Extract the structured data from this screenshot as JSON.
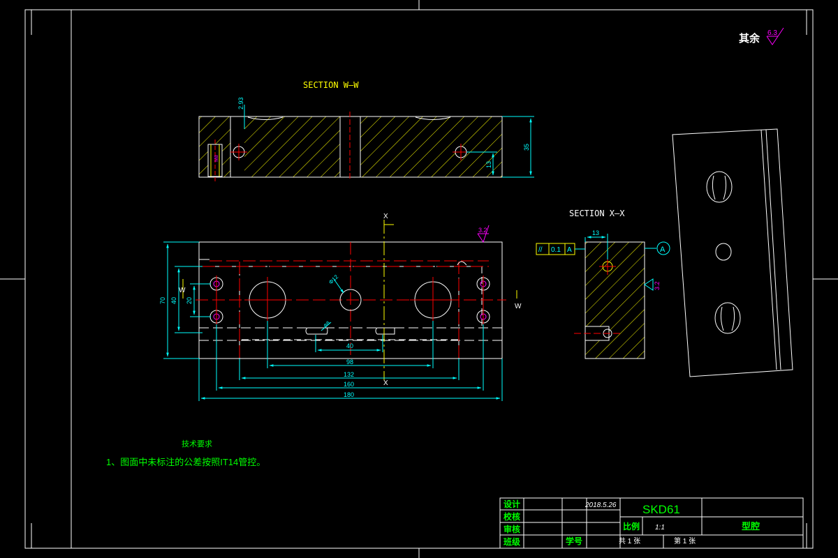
{
  "roughness": {
    "label": "其余",
    "value": "6.3"
  },
  "section_ww": {
    "title": "SECTION W—W",
    "dim_293": "2.93",
    "dim_35": "35",
    "dim_13": "13",
    "dim_m8": "M8"
  },
  "section_xx": {
    "title": "SECTION X—X",
    "dim_13": "13",
    "tol_symbol": "//",
    "tol_value": "0.1",
    "tol_datum": "A",
    "datum_label": "A",
    "rough_32": "3.2"
  },
  "main_view": {
    "cut_x_top": "X",
    "cut_x_bottom": "X",
    "cut_w_left": "W",
    "cut_w_right": "W",
    "rough_32": "3.2",
    "dia_12": "Φ12",
    "dia_8": "Φ8",
    "dim_70": "70",
    "dim_40": "40",
    "dim_20": "20",
    "dim_h40": "40",
    "dim_98": "98",
    "dim_132": "132",
    "dim_160": "160",
    "dim_180": "180"
  },
  "notes": {
    "heading": "技术要求",
    "line1": "1、图面中未标注的公差按照IT14管控。"
  },
  "title_block": {
    "design": "设计",
    "check": "校核",
    "review": "审核",
    "class": "班级",
    "student_no": "学号",
    "date": "2018.5.26",
    "material": "SKD61",
    "scale_label": "比例",
    "scale_value": "1:1",
    "part_name": "型腔",
    "total_sheets": "共 1 张",
    "sheet_no": "第 1 张"
  },
  "colors": {
    "background": "#000000",
    "outline": "#ffffff",
    "hatch": "#ffff00",
    "center": "#ff0000",
    "dimension": "#00ffff",
    "note": "#00ff00",
    "symbol": "#ff00ff"
  }
}
